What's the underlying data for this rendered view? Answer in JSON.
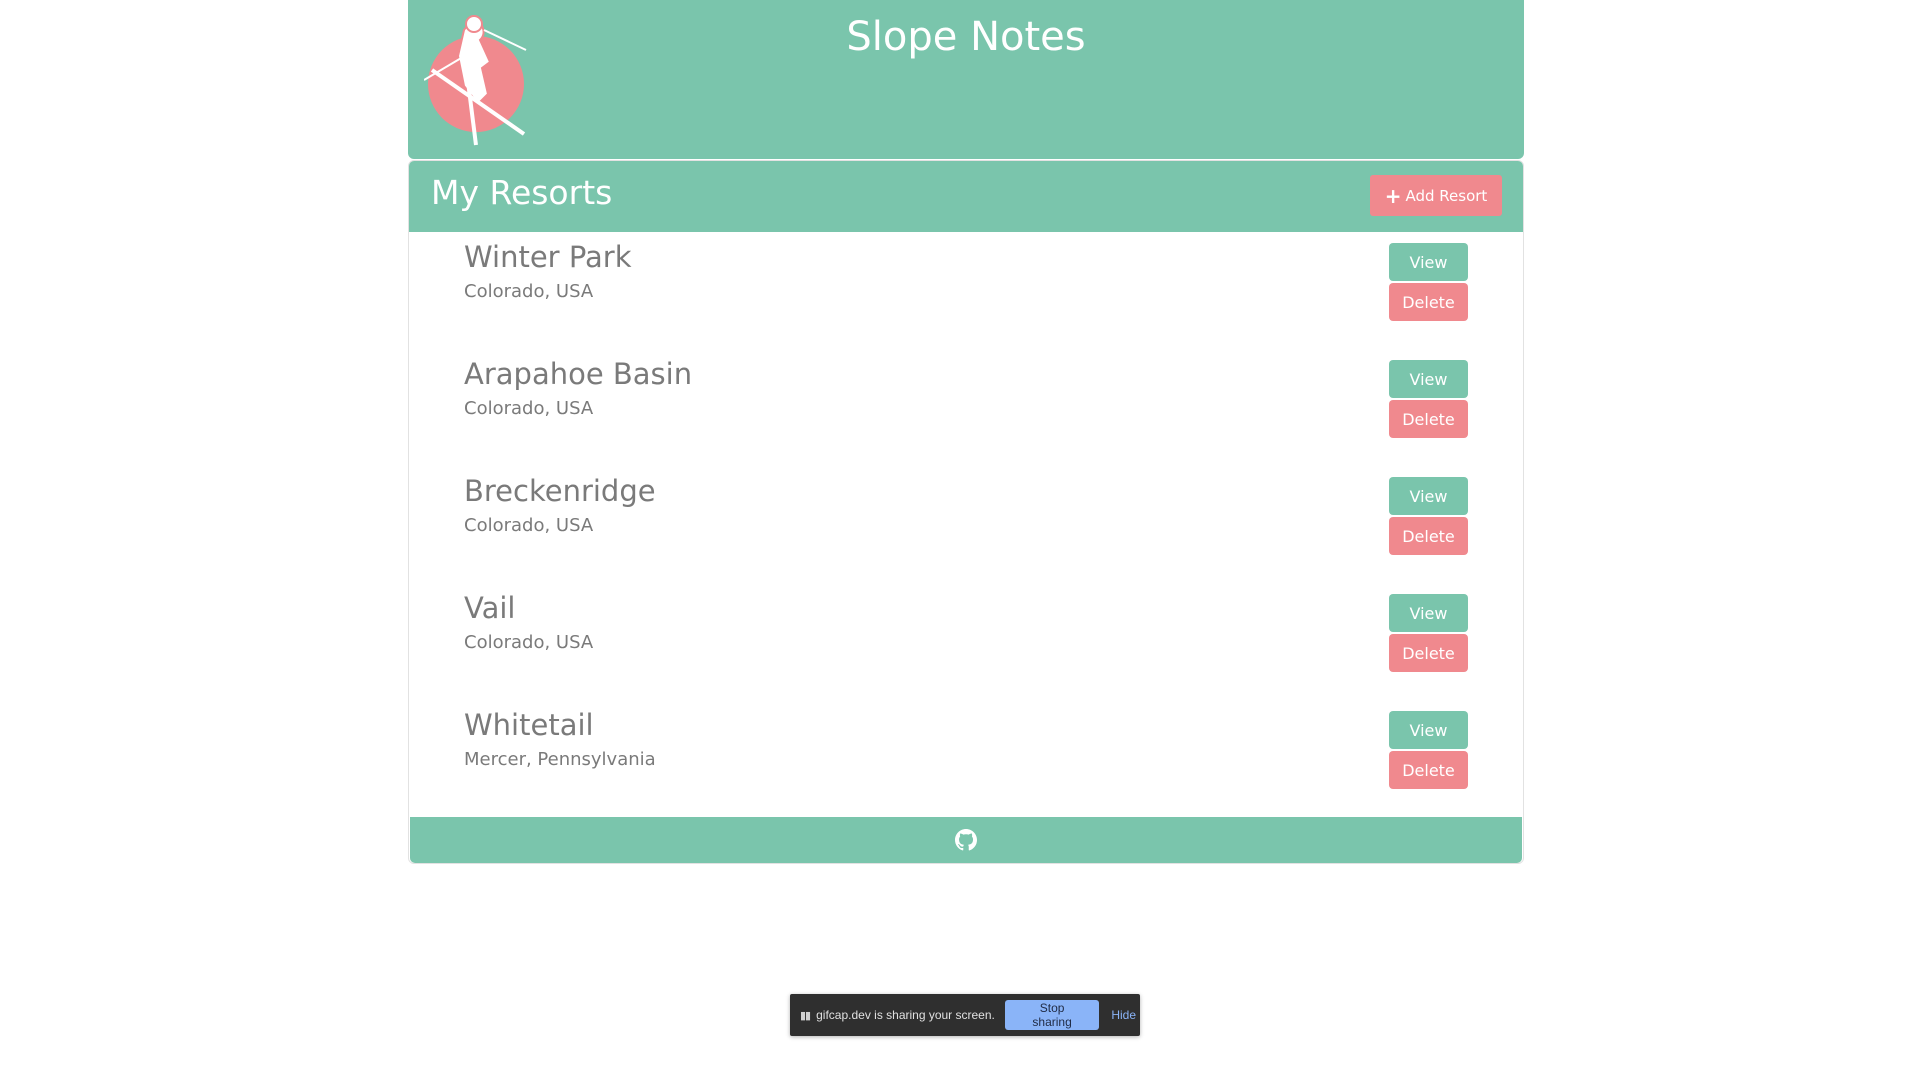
{
  "header": {
    "title": "Slope Notes",
    "logo_icon": "skier-logo-icon"
  },
  "resorts_card": {
    "title": "My Resorts",
    "add_button_label": "Add Resort",
    "add_icon": "plus-icon",
    "items": [
      {
        "name": "Winter Park",
        "location": "Colorado, USA",
        "view_label": "View",
        "delete_label": "Delete"
      },
      {
        "name": "Arapahoe Basin",
        "location": "Colorado, USA",
        "view_label": "View",
        "delete_label": "Delete"
      },
      {
        "name": "Breckenridge",
        "location": "Colorado, USA",
        "view_label": "View",
        "delete_label": "Delete"
      },
      {
        "name": "Vail",
        "location": "Colorado, USA",
        "view_label": "View",
        "delete_label": "Delete"
      },
      {
        "name": "Whitetail",
        "location": "Mercer, Pennsylvania",
        "view_label": "View",
        "delete_label": "Delete"
      }
    ]
  },
  "footer": {
    "github_icon": "github-icon"
  },
  "share_bar": {
    "message": "gifcap.dev is sharing your screen.",
    "stop_label": "Stop sharing",
    "hide_label": "Hide",
    "pause_icon": "pause-icon"
  },
  "colors": {
    "brand_green": "#7ac5ac",
    "accent_pink": "#f0898e",
    "text_gray": "#7a7a7a"
  }
}
